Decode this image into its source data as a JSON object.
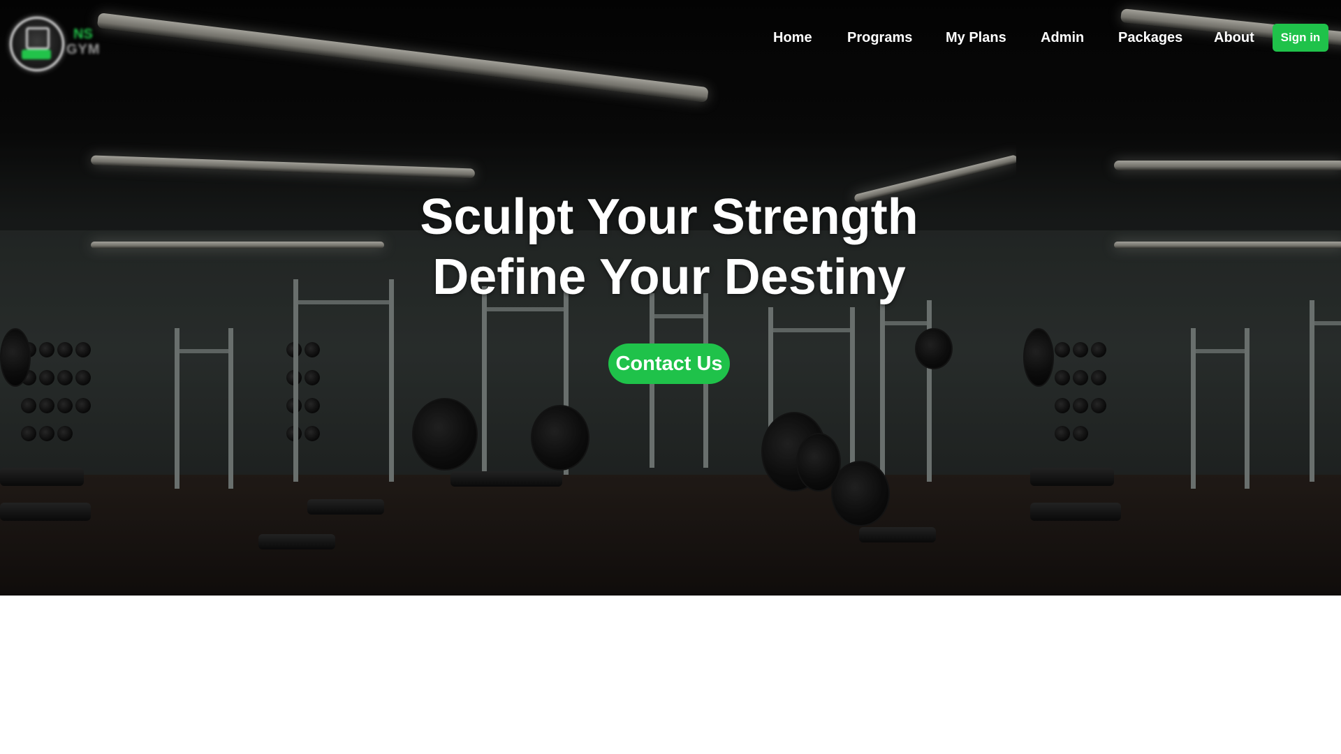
{
  "brand": {
    "logo_icon": "gym-logo-icon",
    "logo_text_top": "NS",
    "logo_text_bottom": "GYM"
  },
  "nav": {
    "items": [
      {
        "label": "Home"
      },
      {
        "label": "Programs"
      },
      {
        "label": "My Plans"
      },
      {
        "label": "Admin"
      },
      {
        "label": "Packages"
      },
      {
        "label": "About"
      }
    ],
    "signin_label": "Sign in"
  },
  "hero": {
    "headline_line1": "Sculpt Your Strength",
    "headline_line2": "Define Your Destiny",
    "cta_label": "Contact Us",
    "background": "gym-interior-photo"
  },
  "colors": {
    "accent": "#1fc24a",
    "nav_text": "#ffffff",
    "page_background": "#ffffff"
  }
}
